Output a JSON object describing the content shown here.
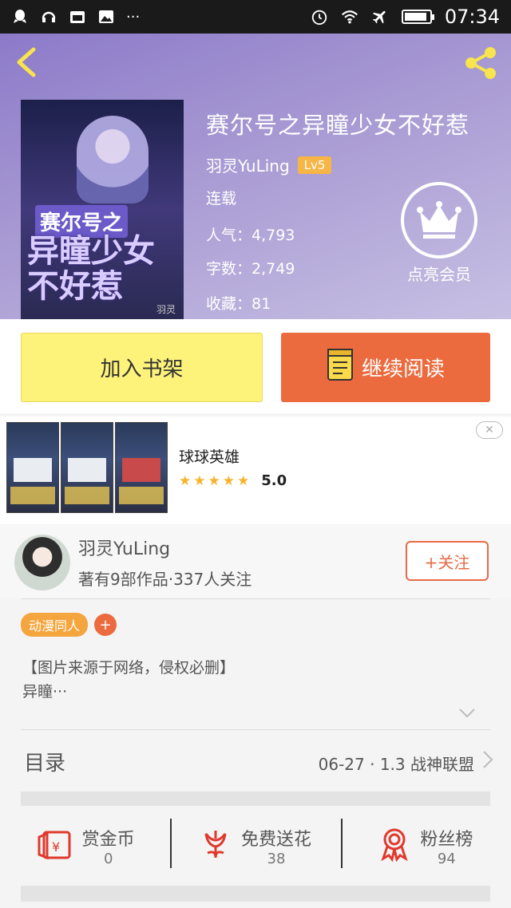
{
  "status_bar": {
    "time": "07:34",
    "left_text": "···"
  },
  "book": {
    "title": "赛尔号之异瞳少女不好惹",
    "author": "羽灵YuLing",
    "level": "Lv5",
    "status": "连载",
    "popularity": "人气：4,793",
    "word_count": "字数：2,749",
    "favorites": "收藏：81",
    "cover": {
      "line1": "赛尔号之",
      "line2": "异瞳少女不好惹",
      "signature": "羽灵"
    }
  },
  "vip": {
    "label": "点亮会员"
  },
  "actions": {
    "add_shelf": "加入书架",
    "continue_read": "继续阅读"
  },
  "ad": {
    "app_name": "球球英雄",
    "rating": "5.0",
    "stars": 5,
    "close": "✕"
  },
  "author_card": {
    "name": "羽灵YuLing",
    "info": "著有9部作品·337人关注",
    "follow_label": "+关注"
  },
  "tags": {
    "items": [
      "动漫同人"
    ],
    "add": "+"
  },
  "description": {
    "line1": "【图片来源于网络，侵权必删】",
    "line2": "异瞳···"
  },
  "toc": {
    "label": "目录",
    "latest": "06-27 · 1.3 战神联盟"
  },
  "stats": [
    {
      "label": "赏金币",
      "value": "0",
      "icon": "red-envelope-icon"
    },
    {
      "label": "免费送花",
      "value": "38",
      "icon": "flower-icon"
    },
    {
      "label": "粉丝榜",
      "value": "94",
      "icon": "ribbon-medal-icon"
    }
  ],
  "colors": {
    "accent": "#eb6a3e",
    "shelf_button": "#fdf27a",
    "level_badge": "#f7b545",
    "tag": "#f5a53d"
  }
}
